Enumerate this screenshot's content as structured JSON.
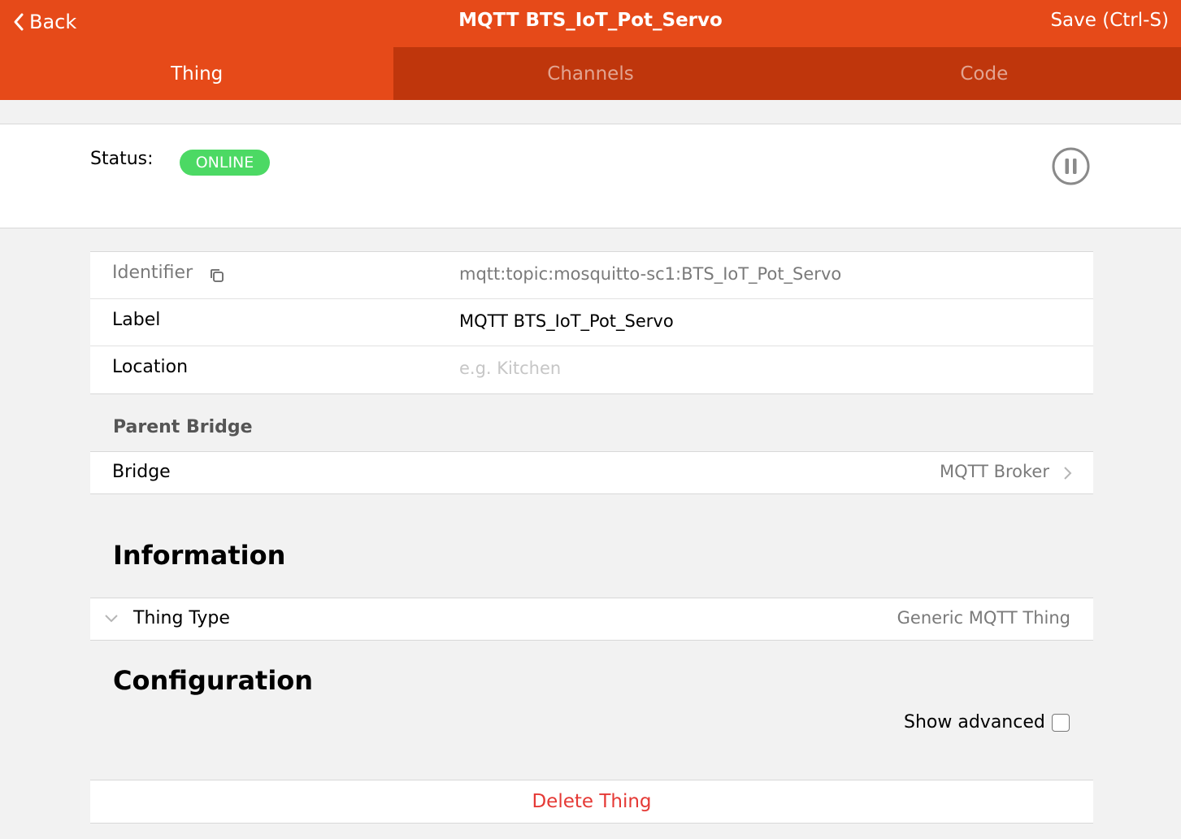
{
  "navbar": {
    "back_label": "Back",
    "title": "MQTT BTS_IoT_Pot_Servo",
    "save_label": "Save (Ctrl-S)"
  },
  "tabs": [
    {
      "label": "Thing",
      "active": true
    },
    {
      "label": "Channels",
      "active": false
    },
    {
      "label": "Code",
      "active": false
    }
  ],
  "status": {
    "label": "Status:",
    "value": "ONLINE",
    "badge_color": "#4cd964"
  },
  "properties": {
    "identifier_label": "Identifier",
    "identifier_value": "mqtt:topic:mosquitto-sc1:BTS_IoT_Pot_Servo",
    "label_label": "Label",
    "label_value": "MQTT BTS_IoT_Pot_Servo",
    "location_label": "Location",
    "location_placeholder": "e.g. Kitchen"
  },
  "parent_bridge": {
    "heading": "Parent Bridge",
    "bridge_label": "Bridge",
    "bridge_value": "MQTT Broker"
  },
  "information": {
    "heading": "Information",
    "thing_type_label": "Thing Type",
    "thing_type_value": "Generic MQTT Thing"
  },
  "configuration": {
    "heading": "Configuration",
    "show_advanced_label": "Show advanced",
    "show_advanced_checked": false
  },
  "delete_label": "Delete Thing",
  "colors": {
    "primary": "#e64a19",
    "tabbar_dark": "#bf360c",
    "danger": "#e53935"
  }
}
